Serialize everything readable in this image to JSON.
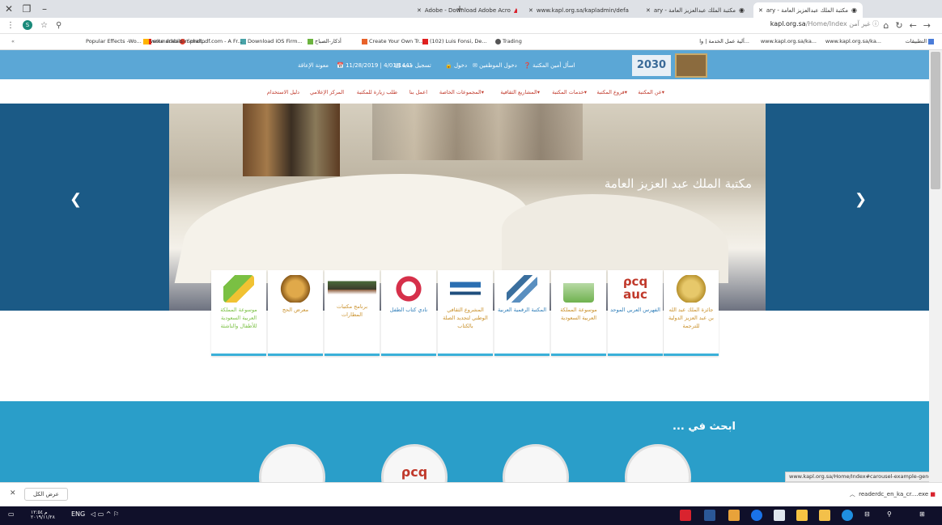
{
  "browser": {
    "tabs": [
      {
        "label": "مكتبة الملك عبدالعزيز العامة - ary",
        "active": true
      },
      {
        "label": "مكتبة الملك عبدالعزيز العامة - ary",
        "active": false
      },
      {
        "label": "www.kapl.org.sa/kapladmin/defa",
        "active": false
      },
      {
        "label": "Adobe - Download Adobe Acro",
        "active": false
      }
    ],
    "url_prefix": "غير آمن",
    "url_domain": "kapl.org.sa",
    "url_path": "/Home/Index",
    "bookmarks": [
      "التطبيقات",
      "www.kapl.org.sa/ka...",
      "www.kapl.org.sa/ka...",
      "آلية عمل الخدمة | وا...",
      "Trading",
      "(102) Luis Fonsi, De...",
      "Create Your Own Tr...",
      "أذكار-الصباح",
      "Download iOS Firm...",
      "Smallpdf.com - A Fr...",
      "sounddeals",
      "write arabic in phot...",
      "Popular Effects -Wo..."
    ]
  },
  "site": {
    "topbar": {
      "ask_librarian": "اسأل أمين المكتبة",
      "staff_login": "دخول الموظفين",
      "login": "دخول",
      "register": "تسجيل جديد",
      "date": "11/28/2019 | 4/01/1441",
      "a11y": "معونة الإعاقة"
    },
    "logo_2030": "2030",
    "menu": [
      "عن المكتبة",
      "فروع المكتبة",
      "خدمات المكتبة",
      "المشاريع الثقافية",
      "المجموعات الخاصة",
      "اعمل بنا",
      "طلب زيارة للمكتبة",
      "المركز الإعلامي",
      "دليل الاستخدام"
    ],
    "hero_title": "مكتبة الملك عبد العزيز العامة",
    "cards": [
      "جائزة الملك عبد الله بن عبد العزيز الدولية للترجمة",
      "الفهرس العربي الموحد",
      "موسوعة المملكة العربية السعودية",
      "المكتبة الرقمية العربية",
      "المشروع الثقافي الوطني لتجديد الصلة بالكتاب",
      "نادي كتاب الطفل",
      "برنامج مكتبات المطارات",
      "معرض الحج",
      "موسوعة المملكة العربية السعودية للأطفال والناشئة"
    ],
    "search_title": "ابحث في ...",
    "status_url": "www.kapl.org.sa/Home/Index#carousel-example-generic"
  },
  "downloads": {
    "show_all": "عرض الكل",
    "file": "readerdc_en_ka_cr....exe"
  },
  "taskbar": {
    "lang": "ENG",
    "time": "م ١٢:٥٤",
    "date": "٢٠١٩/١١/٢٨"
  },
  "colors": {
    "topbar": "#5ba7d6",
    "hero_bg": "#1b5a86",
    "search_bg": "#2a9ec9",
    "menu_text": "#c0392b",
    "card_accent": "#3ab0d8"
  }
}
